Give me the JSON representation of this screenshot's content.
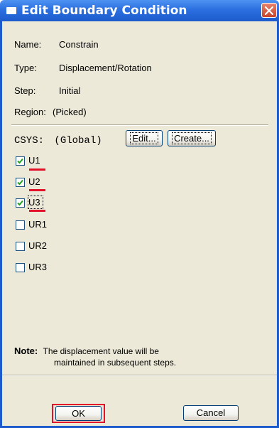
{
  "window": {
    "title": "Edit Boundary Condition"
  },
  "info": {
    "name_label": "Name:",
    "name_value": "Constrain",
    "type_label": "Type:",
    "type_value": "Displacement/Rotation",
    "step_label": "Step:",
    "step_value": "Initial",
    "region_label": "Region:",
    "region_value": "(Picked)"
  },
  "csys": {
    "label": "CSYS:",
    "value": "(Global)",
    "edit_button": "Edit...",
    "create_button": "Create..."
  },
  "dofs": [
    {
      "label": "U1",
      "checked": true
    },
    {
      "label": "U2",
      "checked": true
    },
    {
      "label": "U3",
      "checked": true
    },
    {
      "label": "UR1",
      "checked": false
    },
    {
      "label": "UR2",
      "checked": false
    },
    {
      "label": "UR3",
      "checked": false
    }
  ],
  "note": {
    "label": "Note:",
    "line1": "The displacement value will be",
    "line2": "maintained in subsequent steps."
  },
  "buttons": {
    "ok": "OK",
    "cancel": "Cancel"
  },
  "colors": {
    "titlebar": "#2b6fe0",
    "dialog_bg": "#ece9d8",
    "highlight": "#e3112a"
  }
}
